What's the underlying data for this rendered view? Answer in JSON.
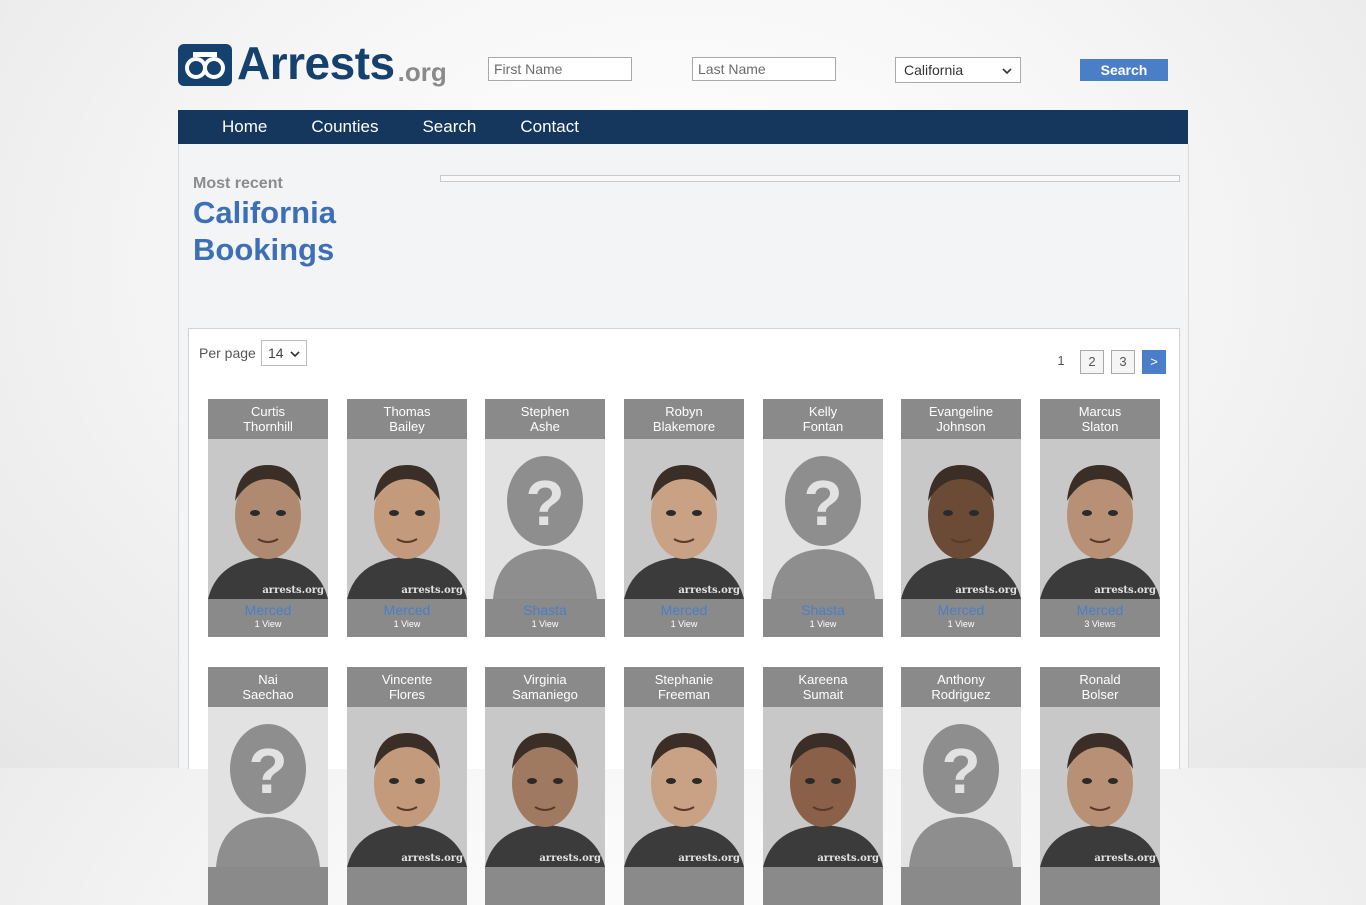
{
  "header": {
    "logo_main": "Arrests",
    "logo_ext": ".org",
    "first_name_placeholder": "First Name",
    "last_name_placeholder": "Last Name",
    "state_value": "California",
    "search_label": "Search"
  },
  "nav": {
    "items": [
      "Home",
      "Counties",
      "Search",
      "Contact"
    ]
  },
  "intro": {
    "kicker": "Most recent",
    "title_line1": "California",
    "title_line2": "Bookings"
  },
  "listing": {
    "per_page_label": "Per page",
    "per_page_value": "14",
    "pages": [
      "1",
      "2",
      "3"
    ],
    "next_label": ">"
  },
  "colors": {
    "brand": "#15416e",
    "nav_bg": "#15375e",
    "accent": "#4a7ec7",
    "card_bg": "#8a8a8a"
  },
  "bookings": [
    {
      "first": "Curtis",
      "last": "Thornhill",
      "county": "Merced",
      "views": "1 View",
      "photo": "mugshot"
    },
    {
      "first": "Thomas",
      "last": "Bailey",
      "county": "Merced",
      "views": "1 View",
      "photo": "mugshot"
    },
    {
      "first": "Stephen",
      "last": "Ashe",
      "county": "Shasta",
      "views": "1 View",
      "photo": "placeholder"
    },
    {
      "first": "Robyn",
      "last": "Blakemore",
      "county": "Merced",
      "views": "1 View",
      "photo": "mugshot"
    },
    {
      "first": "Kelly",
      "last": "Fontan",
      "county": "Shasta",
      "views": "1 View",
      "photo": "placeholder"
    },
    {
      "first": "Evangeline",
      "last": "Johnson",
      "county": "Merced",
      "views": "1 View",
      "photo": "mugshot"
    },
    {
      "first": "Marcus",
      "last": "Slaton",
      "county": "Merced",
      "views": "3 Views",
      "photo": "mugshot"
    },
    {
      "first": "Nai",
      "last": "Saechao",
      "county": "",
      "views": "",
      "photo": "placeholder"
    },
    {
      "first": "Vincente",
      "last": "Flores",
      "county": "",
      "views": "",
      "photo": "mugshot"
    },
    {
      "first": "Virginia",
      "last": "Samaniego",
      "county": "",
      "views": "",
      "photo": "mugshot"
    },
    {
      "first": "Stephanie",
      "last": "Freeman",
      "county": "",
      "views": "",
      "photo": "mugshot"
    },
    {
      "first": "Kareena",
      "last": "Sumait",
      "county": "",
      "views": "",
      "photo": "mugshot"
    },
    {
      "first": "Anthony",
      "last": "Rodriguez",
      "county": "",
      "views": "",
      "photo": "placeholder"
    },
    {
      "first": "Ronald",
      "last": "Bolser",
      "county": "",
      "views": "",
      "photo": "mugshot"
    }
  ],
  "watermark": "arrests.org"
}
